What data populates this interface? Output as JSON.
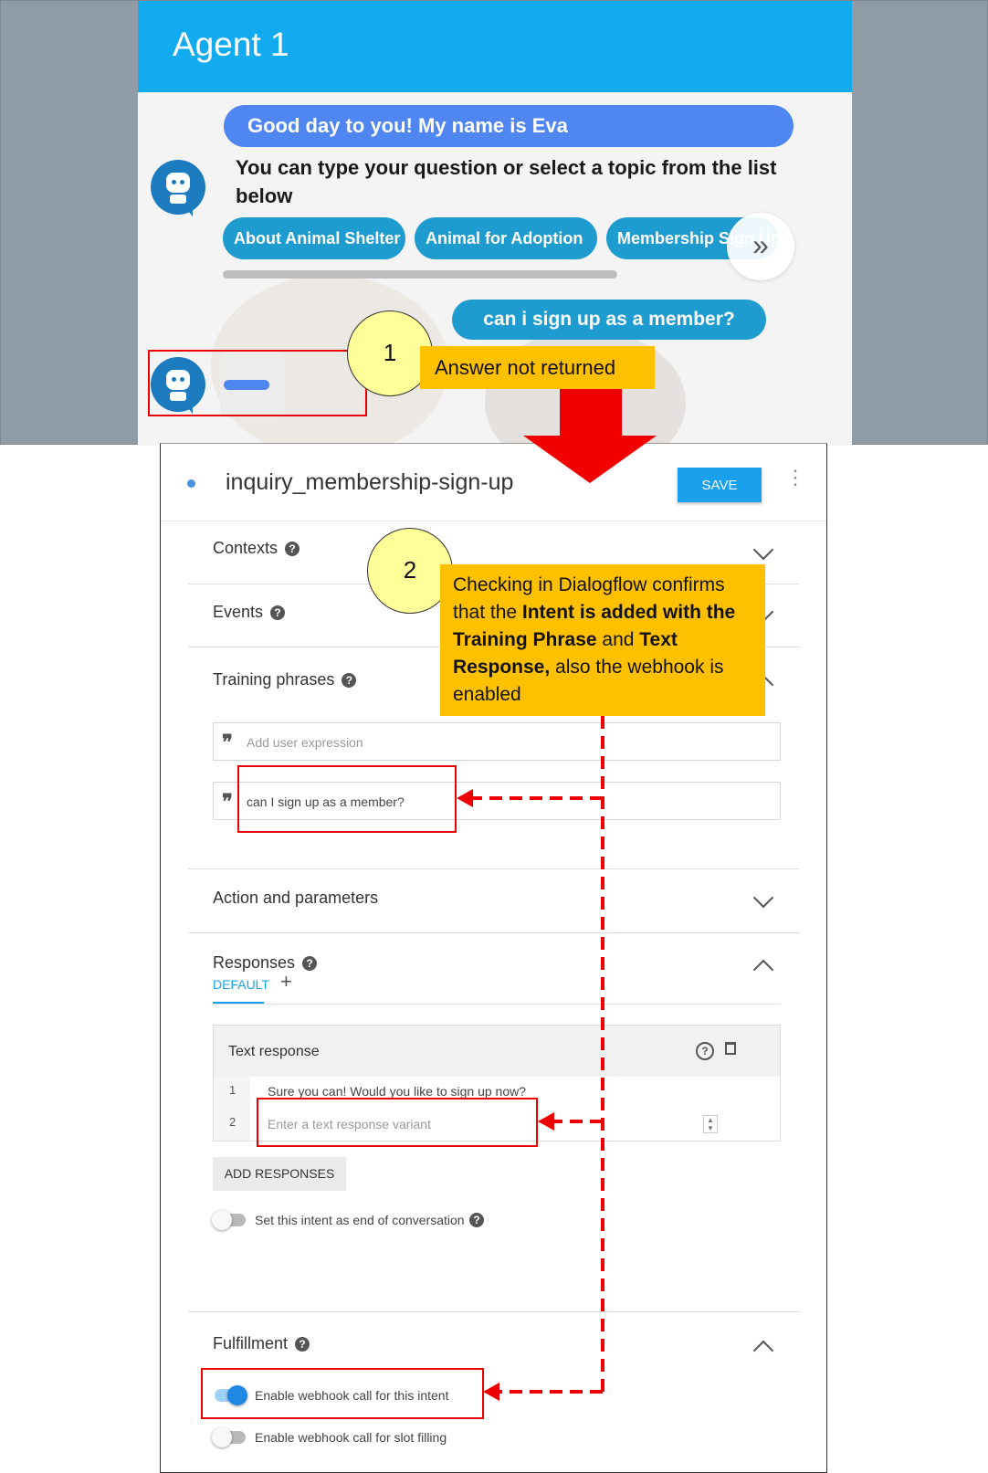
{
  "chat": {
    "title": "Agent 1",
    "greeting": "Good day to you! My name is Eva",
    "intro": "You can type your question or select a topic from the list below",
    "chips": [
      "About Animal Shelter",
      "Animal for Adoption",
      "Membership Sign Up"
    ],
    "next_glyph": "»",
    "user_message": "can i sign up as a member?"
  },
  "callouts": {
    "one": {
      "number": "1",
      "label": "Answer not returned"
    },
    "two": {
      "number": "2",
      "text_parts": [
        "Checking in Dialogflow confirms that the ",
        "Intent is added with the Training Phrase",
        " and ",
        "Text Response,",
        " also the webhook is enabled"
      ]
    }
  },
  "dialogflow": {
    "intent_name": "inquiry_membership-sign-up",
    "save_label": "SAVE",
    "more_menu": "⋮",
    "sections": {
      "contexts": "Contexts",
      "events": "Events",
      "training_phrases": "Training phrases",
      "action_parameters": "Action and parameters",
      "responses": "Responses",
      "fulfillment": "Fulfillment"
    },
    "help_glyph": "?",
    "training": {
      "quote_glyph": "❞",
      "placeholder": "Add user expression",
      "phrases": [
        "can I sign up as a member?"
      ]
    },
    "responses": {
      "tab_default": "DEFAULT",
      "tab_add": "+",
      "text_response_title": "Text response",
      "rows": [
        {
          "num": "1",
          "text": "Sure you can! Would you like to sign up now?"
        },
        {
          "num": "2",
          "text": "Enter a text response variant"
        }
      ],
      "add_responses": "ADD RESPONSES",
      "end_conversation_label": "Set this intent as end of conversation",
      "end_conversation_enabled": false
    },
    "fulfillment": {
      "webhook_label": "Enable webhook call for this intent",
      "webhook_enabled": true,
      "slot_filling_label": "Enable webhook call for slot filling",
      "slot_filling_enabled": false
    }
  },
  "colors": {
    "header_blue": "#13abef",
    "bubble_blue": "#4f86f2",
    "chip_teal": "#1e9cd0",
    "callout_orange": "#ffc000",
    "callout_circle": "#ffff99",
    "annotation_red": "#e00000",
    "save_blue": "#18a0ed"
  }
}
